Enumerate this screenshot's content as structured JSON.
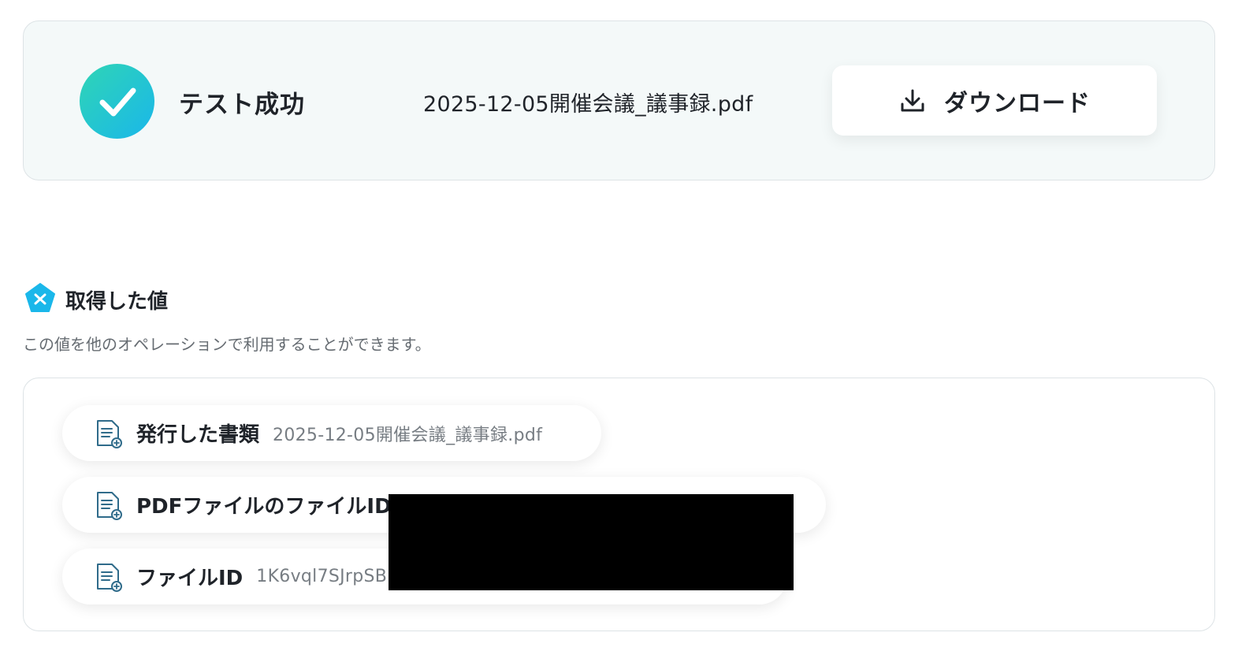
{
  "result": {
    "status_label": "テスト成功",
    "file_name": "2025-12-05開催会議_議事録.pdf",
    "download_label": "ダウンロード"
  },
  "values_section": {
    "title": "取得した値",
    "description": "この値を他のオペレーションで利用することができます。",
    "items": [
      {
        "label": "発行した書類",
        "value": "2025-12-05開催会議_議事録.pdf"
      },
      {
        "label": "PDFファイルのファイルID",
        "value": ""
      },
      {
        "label": "ファイルID",
        "value": "1K6vql7SJrpSB"
      }
    ]
  },
  "colors": {
    "success_gradient_start": "#2fd5b5",
    "success_gradient_end": "#1ab7ea",
    "section_icon": "#1ab7ea",
    "card_background": "#f4f9f9"
  },
  "icons": {
    "status": "check-icon",
    "download": "download-icon",
    "section": "variable-icon",
    "item": "document-icon"
  }
}
